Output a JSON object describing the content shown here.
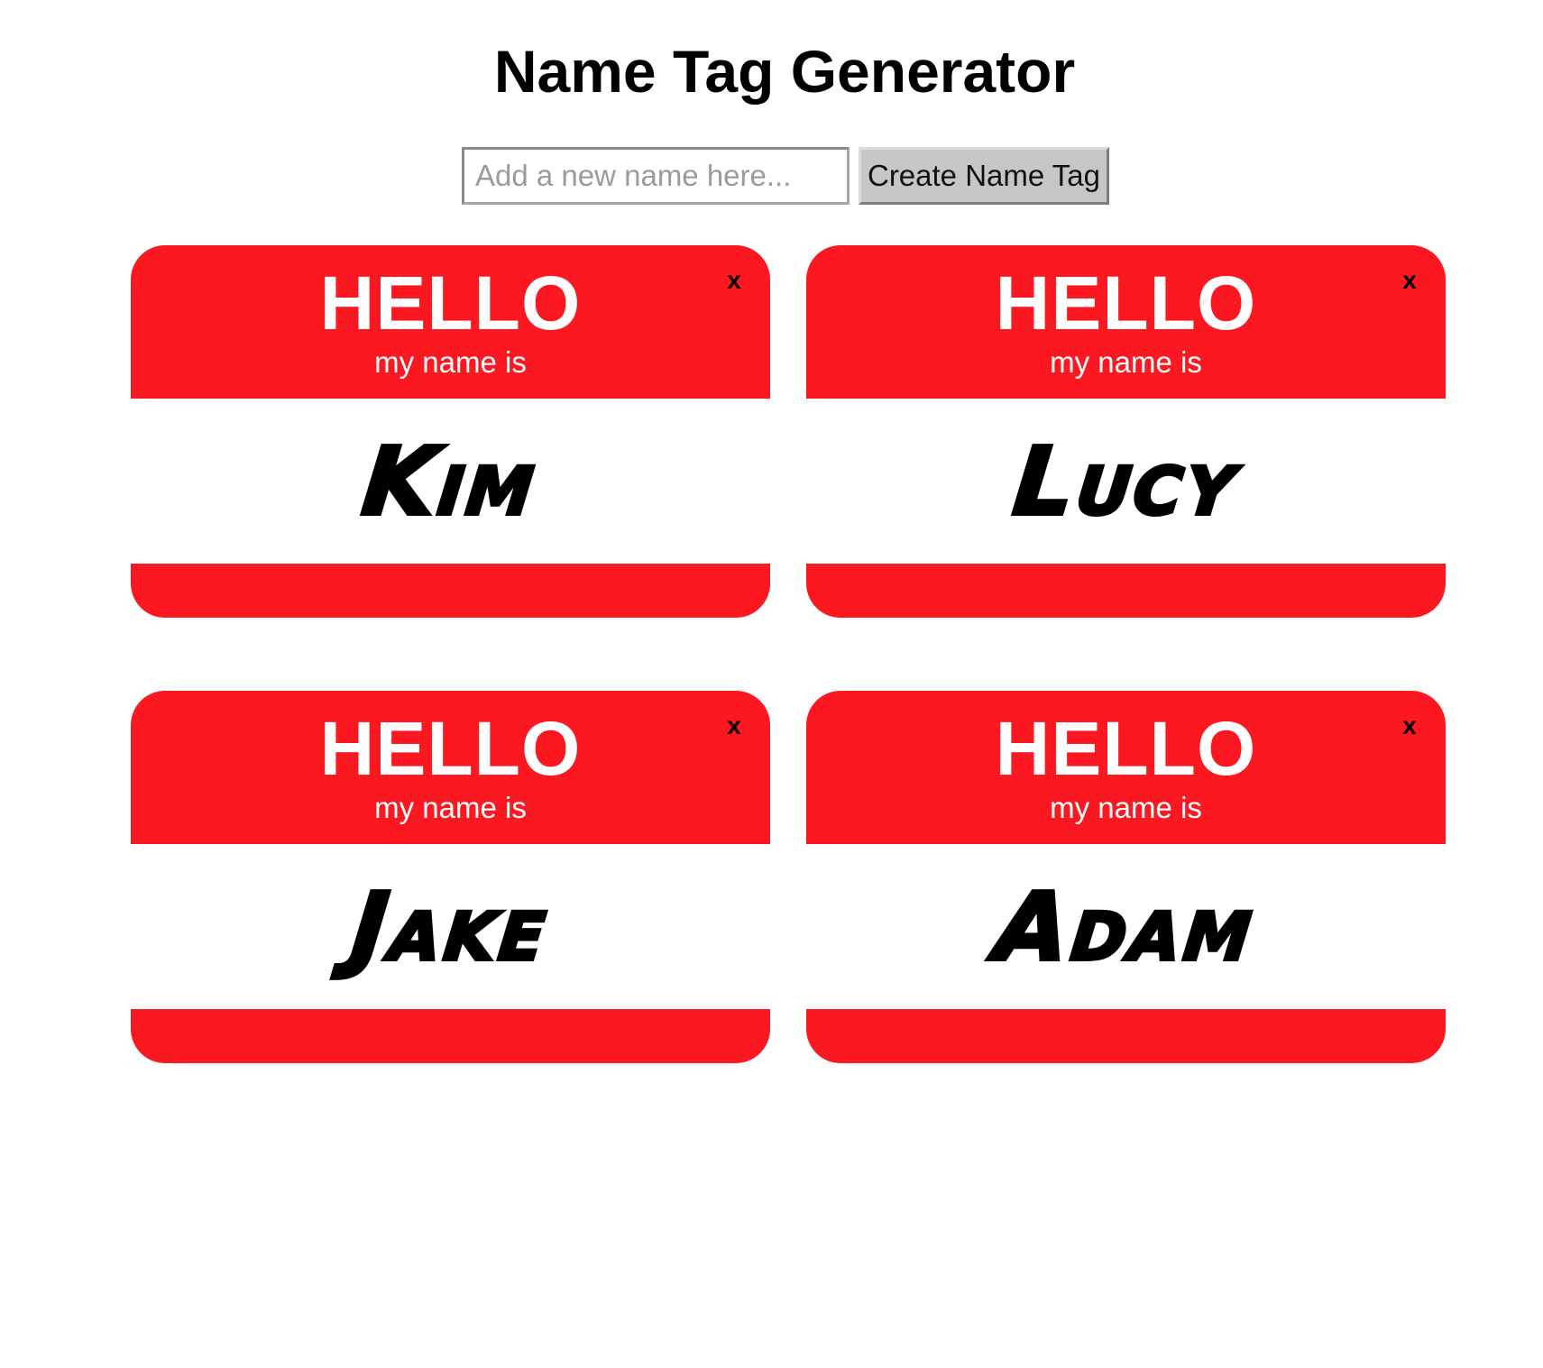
{
  "title": "Name Tag Generator",
  "form": {
    "placeholder": "Add a new name here...",
    "value": "",
    "button_label": "Create Name Tag"
  },
  "tags": [
    {
      "hello": "HELLO",
      "subtitle": "my name is",
      "name": "Kim",
      "close": "x"
    },
    {
      "hello": "HELLO",
      "subtitle": "my name is",
      "name": "Lucy",
      "close": "x"
    },
    {
      "hello": "HELLO",
      "subtitle": "my name is",
      "name": "Jake",
      "close": "x"
    },
    {
      "hello": "HELLO",
      "subtitle": "my name is",
      "name": "Adam",
      "close": "x"
    }
  ],
  "colors": {
    "tag_red": "#fb1820",
    "tag_text": "#ffffff",
    "name_ink": "#000000",
    "button_bg": "#c6c6c6"
  }
}
